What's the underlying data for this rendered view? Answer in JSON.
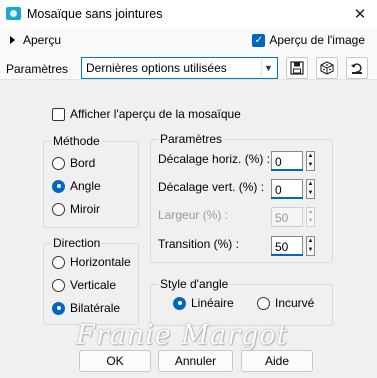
{
  "window": {
    "title": "Mosaïque sans jointures",
    "close_icon": "close-icon"
  },
  "header": {
    "preview_toggle_label": "Aperçu",
    "show_preview_label": "Aperçu de l'image",
    "params_label": "Paramètres",
    "preset_value": "Dernières options utilisées"
  },
  "mosaic_preview_label": "Afficher l'aperçu de la mosaïque",
  "methode": {
    "label": "Méthode",
    "options": [
      "Bord",
      "Angle",
      "Miroir"
    ],
    "selected": "Angle"
  },
  "direction": {
    "label": "Direction",
    "options": [
      "Horizontale",
      "Verticale",
      "Bilatérale"
    ],
    "selected": "Bilatérale"
  },
  "parametres": {
    "label": "Paramètres",
    "rows": [
      {
        "label": "Décalage horiz. (%) :",
        "value": "0",
        "enabled": true
      },
      {
        "label": "Décalage vert. (%) :",
        "value": "0",
        "enabled": true
      },
      {
        "label": "Largeur (%) :",
        "value": "50",
        "enabled": false
      },
      {
        "label": "Transition (%) :",
        "value": "50",
        "enabled": true
      }
    ]
  },
  "style_angle": {
    "label": "Style d'angle",
    "options": [
      "Linéaire",
      "Incurvé"
    ],
    "selected": "Linéaire"
  },
  "buttons": {
    "ok": "OK",
    "cancel": "Annuler",
    "help": "Aide"
  },
  "watermark": "Franie Margot",
  "colors": {
    "accent": "#0067c0",
    "app_icon": "#1aa6cf"
  }
}
